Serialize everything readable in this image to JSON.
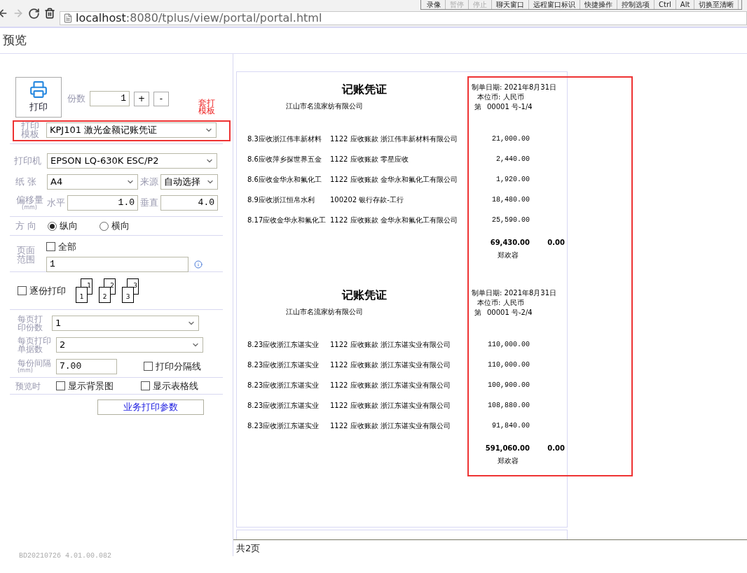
{
  "browser": {
    "url_host": "localhost",
    "url_path": ":8080/tplus/view/portal/portal.html",
    "remote_toolbar": [
      {
        "label": "录像",
        "disabled": false
      },
      {
        "label": "暂停",
        "disabled": true
      },
      {
        "label": "停止",
        "disabled": true
      },
      {
        "label": "聊天窗口",
        "disabled": false
      },
      {
        "label": "远程窗口标识",
        "disabled": false
      },
      {
        "label": "快捷操作",
        "disabled": false
      },
      {
        "label": "控制选项",
        "disabled": false
      },
      {
        "label": "Ctrl",
        "disabled": false
      },
      {
        "label": "Alt",
        "disabled": false
      },
      {
        "label": "切换至清晰",
        "disabled": false
      }
    ]
  },
  "title": "预览",
  "print_panel": {
    "print_button": "打印",
    "copies": {
      "label": "份数",
      "value": "1",
      "plus": "+",
      "minus": "-"
    },
    "overlay_note": "套打模板",
    "template": {
      "label": "打印模板",
      "value": "KPJ101 激光金额记账凭证"
    },
    "printer": {
      "label": "打印机",
      "value": "EPSON LQ-630K ESC/P2"
    },
    "paper": {
      "label": "纸 张",
      "value": "A4"
    },
    "source": {
      "label": "来源",
      "value": "自动选择"
    },
    "offset": {
      "label": "偏移量",
      "unit": "(mm)",
      "horizontal_label": "水平",
      "horizontal": "1.0",
      "vertical_label": "垂直",
      "vertical": "4.0"
    },
    "orientation": {
      "label": "方 向",
      "options": [
        {
          "label": "纵向",
          "selected": true
        },
        {
          "label": "横向",
          "selected": false
        }
      ]
    },
    "page_range": {
      "label": "页面范围",
      "all": {
        "label": "全部",
        "checked": false
      },
      "value": "1"
    },
    "collate": {
      "label": "逐份打印",
      "checked": false,
      "sets": [
        {
          "back": "1",
          "front": "1"
        },
        {
          "back": "2",
          "front": "2"
        },
        {
          "back": "3",
          "front": "3"
        }
      ]
    },
    "copies_per_page": {
      "label": "每页打印份数",
      "value": "1"
    },
    "vouchers_per_page": {
      "label": "每页打印单据数",
      "value": "2"
    },
    "gap": {
      "label": "每份间隔",
      "unit": "(mm)",
      "value": "7.00"
    },
    "separator": {
      "label": "打印分隔线",
      "checked": false
    },
    "preview_options": {
      "label": "预览时",
      "options": [
        {
          "label": "显示背景图",
          "checked": false
        },
        {
          "label": "显示表格线",
          "checked": false
        }
      ]
    },
    "business_params_button": "业务打印参数",
    "version": "BD20210726 4.01.00.082"
  },
  "preview": {
    "vouchers": [
      {
        "title": "记账凭证",
        "company": "江山市名流家纺有限公司",
        "date": "制单日期: 2021年8月31日",
        "currency": "本位币: 人民币",
        "number_prefix": "第",
        "number": "00001 号-1/4",
        "rows": [
          {
            "summary": "8.3应收浙江伟丰新材料",
            "account": "1122 应收账款 浙江伟丰新材料有限公司",
            "amount": "21,000.00"
          },
          {
            "summary": "8.6应收萍乡探世界五金",
            "account": "1122 应收账款 零星应收",
            "amount": "2,440.00"
          },
          {
            "summary": "8.6应收金华永和氟化工",
            "account": "1122 应收账款 金华永和氟化工有限公司",
            "amount": "1,920.00"
          },
          {
            "summary": "8.9应收浙江恒帛水利",
            "account": "100202 银行存款-工行",
            "amount": "18,480.00"
          },
          {
            "summary": "8.17应收金华永和氟化工",
            "account": "1122 应收账款 金华永和氟化工有限公司",
            "amount": "25,590.00"
          }
        ],
        "debit_total": "69,430.00",
        "credit_total": "0.00",
        "maker": "郑欢容"
      },
      {
        "title": "记账凭证",
        "company": "江山市名流家纺有限公司",
        "date": "制单日期: 2021年8月31日",
        "currency": "本位币: 人民币",
        "number_prefix": "第",
        "number": "00001 号-2/4",
        "rows": [
          {
            "summary": "8.23应收浙江东谌实业",
            "account": "1122 应收账款 浙江东谌实业有限公司",
            "amount": "110,000.00"
          },
          {
            "summary": "8.23应收浙江东谌实业",
            "account": "1122 应收账款 浙江东谌实业有限公司",
            "amount": "110,000.00"
          },
          {
            "summary": "8.23应收浙江东谌实业",
            "account": "1122 应收账款 浙江东谌实业有限公司",
            "amount": "100,900.00"
          },
          {
            "summary": "8.23应收浙江东谌实业",
            "account": "1122 应收账款 浙江东谌实业有限公司",
            "amount": "108,880.00"
          },
          {
            "summary": "8.23应收浙江东谌实业",
            "account": "1122 应收账款 浙江东谌实业有限公司",
            "amount": "91,840.00"
          }
        ],
        "debit_total": "591,060.00",
        "credit_total": "0.00",
        "maker": "郑欢容"
      }
    ],
    "status": "共2页"
  }
}
